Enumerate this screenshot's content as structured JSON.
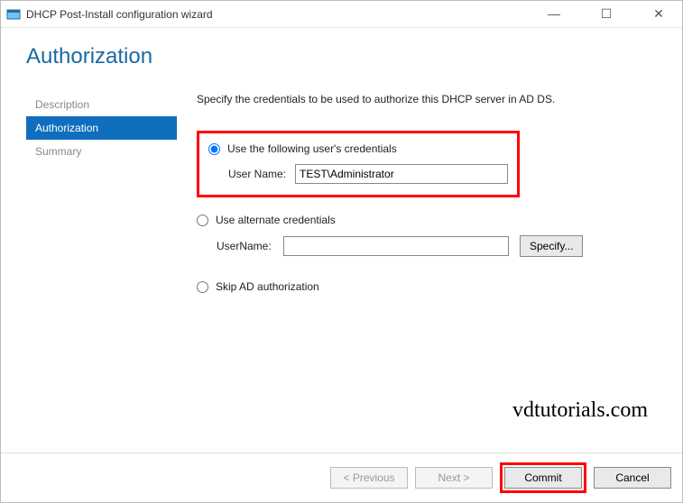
{
  "window": {
    "title": "DHCP Post-Install configuration wizard"
  },
  "heading": "Authorization",
  "sidebar": {
    "items": [
      {
        "label": "Description"
      },
      {
        "label": "Authorization"
      },
      {
        "label": "Summary"
      }
    ]
  },
  "content": {
    "instruction": "Specify the credentials to be used to authorize this DHCP server in AD DS.",
    "option1": {
      "label": "Use the following user's credentials",
      "field_label": "User Name:",
      "value": "TEST\\Administrator"
    },
    "option2": {
      "label": "Use alternate credentials",
      "field_label": "UserName:",
      "value": "",
      "specify_button": "Specify..."
    },
    "option3": {
      "label": "Skip AD authorization"
    }
  },
  "watermark": "vdtutorials.com",
  "footer": {
    "previous": "< Previous",
    "next": "Next >",
    "commit": "Commit",
    "cancel": "Cancel"
  }
}
